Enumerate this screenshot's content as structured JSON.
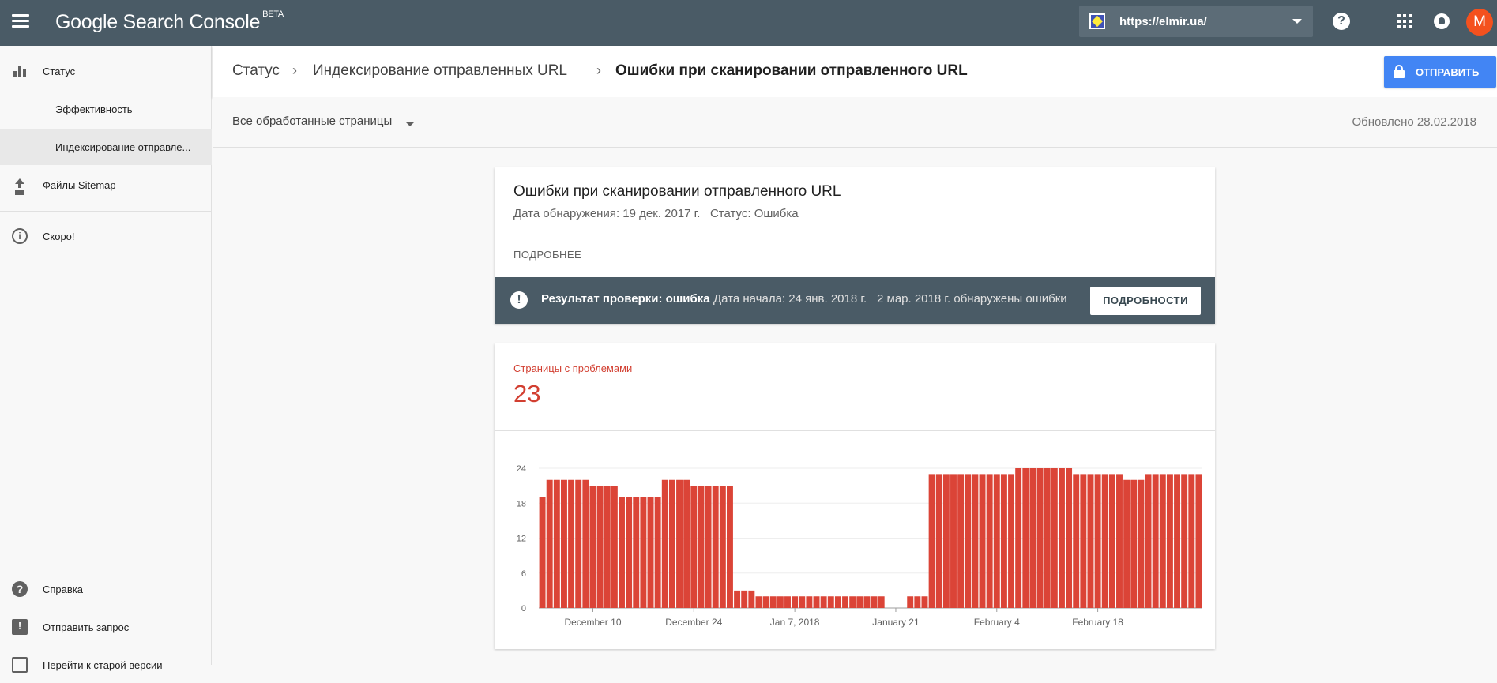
{
  "app": {
    "title": "Google Search Console",
    "beta": "BETA",
    "property_url": "https://elmir.ua/",
    "avatar_letter": "M"
  },
  "sidebar": {
    "items": [
      {
        "label": "Статус",
        "icon": "bar-chart-icon"
      },
      {
        "label": "Эффективность"
      },
      {
        "label": "Индексирование отправле..."
      },
      {
        "label": "Файлы Sitemap",
        "icon": "upload-icon"
      },
      {
        "label": "Скоро!",
        "icon": "info-icon"
      },
      {
        "label": "Справка",
        "icon": "help-icon"
      },
      {
        "label": "Отправить запрос",
        "icon": "feedback-icon"
      },
      {
        "label": "Перейти к старой версии",
        "icon": "switch-icon"
      }
    ]
  },
  "breadcrumb": {
    "items": [
      "Статус",
      "Индексирование отправленных URL",
      "Ошибки при сканировании отправленного URL"
    ]
  },
  "submit_button": "ОТПРАВИТЬ",
  "filter": {
    "selected": "Все обработанные страницы",
    "updated": "Обновлено 28.02.2018"
  },
  "issue": {
    "title": "Ошибки при сканировании отправленного URL",
    "meta": "Дата обнаружения: 19 дек. 2017 г.   Статус: Ошибка",
    "more": "ПОДРОБНЕЕ",
    "validation_result": "Результат проверки: ошибка",
    "validation_start": "Дата начала: 24 янв. 2018 г.",
    "validation_found": "2 мар. 2018 г. обнаружены ошибки",
    "details_button": "ПОДРОБНОСТИ"
  },
  "metric": {
    "label": "Страницы с проблемами",
    "value": "23"
  },
  "colors": {
    "topbar": "#4a5b66",
    "accent_red": "#db4437",
    "submit_blue": "#4285f4"
  },
  "chart_data": {
    "type": "bar",
    "title": "",
    "xlabel": "",
    "ylabel": "",
    "ylim": [
      0,
      24
    ],
    "y_ticks": [
      0,
      6,
      12,
      18,
      24
    ],
    "x_tick_labels": [
      "December 10",
      "December 24",
      "Jan 7, 2018",
      "January 21",
      "February 4",
      "February 18"
    ],
    "x_tick_day_index": [
      7,
      21,
      35,
      49,
      63,
      77
    ],
    "values": [
      19,
      22,
      22,
      22,
      22,
      22,
      22,
      21,
      21,
      21,
      21,
      19,
      19,
      19,
      19,
      19,
      19,
      22,
      22,
      22,
      22,
      21,
      21,
      21,
      21,
      21,
      21,
      3,
      3,
      3,
      2,
      2,
      2,
      2,
      2,
      2,
      2,
      2,
      2,
      2,
      2,
      2,
      2,
      2,
      2,
      2,
      2,
      2,
      0,
      0,
      0,
      2,
      2,
      2,
      23,
      23,
      23,
      23,
      23,
      23,
      23,
      23,
      23,
      23,
      23,
      23,
      24,
      24,
      24,
      24,
      24,
      24,
      24,
      24,
      23,
      23,
      23,
      23,
      23,
      23,
      23,
      22,
      22,
      22,
      23,
      23,
      23,
      23,
      23,
      23,
      23,
      23
    ],
    "grid": true,
    "legend": "none"
  }
}
